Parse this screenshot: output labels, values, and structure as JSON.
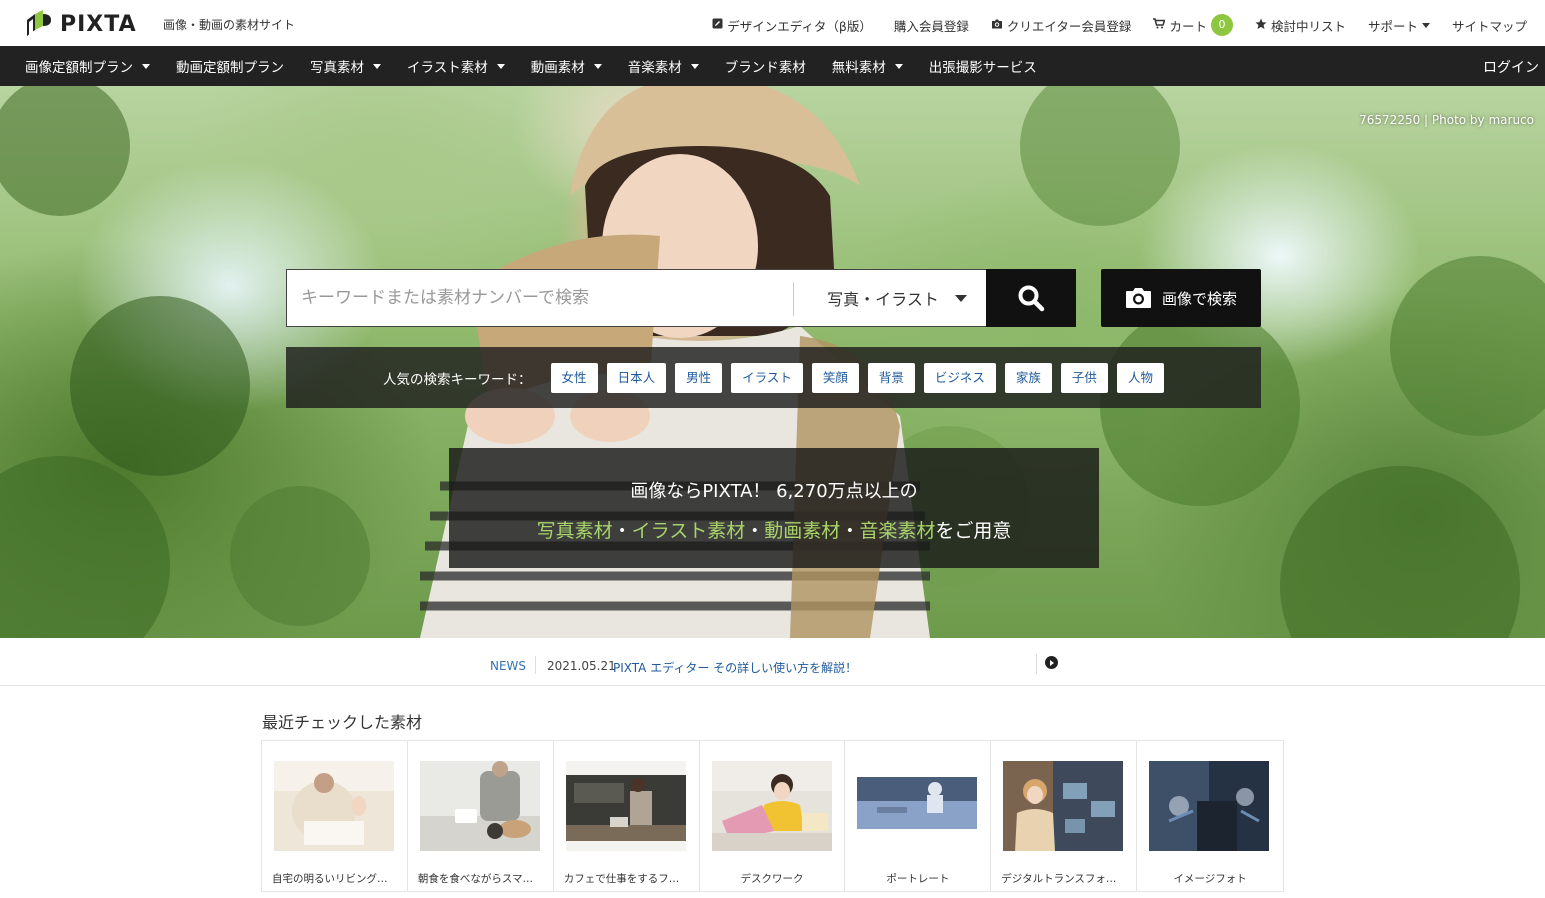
{
  "header": {
    "logo_text": "PIXTA",
    "tagline": "画像・動画の素材サイト",
    "links": [
      {
        "icon": "pencil-icon",
        "label": "デザインエディタ（β版）"
      },
      {
        "icon": "",
        "label": "購入会員登録"
      },
      {
        "icon": "camera-icon",
        "label": "クリエイター会員登録"
      },
      {
        "icon": "cart-icon",
        "label": "カート",
        "badge": "0"
      },
      {
        "icon": "star-icon",
        "label": "検討中リスト"
      },
      {
        "icon": "",
        "label": "サポート",
        "dropdown": true
      },
      {
        "icon": "",
        "label": "サイトマップ"
      }
    ]
  },
  "nav": {
    "items": [
      {
        "label": "画像定額制プラン",
        "dropdown": true
      },
      {
        "label": "動画定額制プラン",
        "dropdown": false
      },
      {
        "label": "写真素材",
        "dropdown": true
      },
      {
        "label": "イラスト素材",
        "dropdown": true
      },
      {
        "label": "動画素材",
        "dropdown": true
      },
      {
        "label": "音楽素材",
        "dropdown": true
      },
      {
        "label": "ブランド素材",
        "dropdown": false
      },
      {
        "label": "無料素材",
        "dropdown": true
      },
      {
        "label": "出張撮影サービス",
        "dropdown": false
      }
    ],
    "login": "ログイン"
  },
  "hero": {
    "photo_id": "76572250",
    "photo_credit_sep": " | Photo by ",
    "photographer": "maruco",
    "search": {
      "placeholder": "キーワードまたは素材ナンバーで検索",
      "value": "",
      "category": "写真・イラスト"
    },
    "image_search_label": "画像で検索",
    "popular_label": "人気の検索キーワード：",
    "keywords": [
      "女性",
      "日本人",
      "男性",
      "イラスト",
      "笑顔",
      "背景",
      "ビジネス",
      "家族",
      "子供",
      "人物"
    ],
    "promo": {
      "line1": "画像ならPIXTA！ 6,270万点以上の",
      "links": [
        "写真素材",
        "イラスト素材",
        "動画素材",
        "音楽素材"
      ],
      "separator": "・",
      "suffix": "をご用意"
    }
  },
  "news": {
    "label": "NEWS",
    "date": "2021.05.21",
    "text": "PIXTA エディター その詳しい使い方を解説！"
  },
  "recent": {
    "title": "最近チェックした素材",
    "items": [
      {
        "caption": "自宅の明るいリビングで…",
        "palette": [
          "#efe6da",
          "#d9cbb8",
          "#f4efe8"
        ]
      },
      {
        "caption": "朝食を食べながらスマー…",
        "palette": [
          "#e9e9e6",
          "#9b9b96",
          "#c9a27a"
        ]
      },
      {
        "caption": "カフェで仕事をするフリ…",
        "palette": [
          "#3a3a36",
          "#7a6a58",
          "#d8d4cc"
        ]
      },
      {
        "caption": "デスクワーク",
        "palette": [
          "#e6e2dc",
          "#e59ab4",
          "#f1c232"
        ]
      },
      {
        "caption": "ポートレート",
        "palette": [
          "#4a5d7a",
          "#8aa2c8",
          "#dfe6f0"
        ]
      },
      {
        "caption": "デジタルトランスフォー…",
        "palette": [
          "#3e4a5c",
          "#d8a56a",
          "#9fc6e0"
        ]
      },
      {
        "caption": "イメージフォト",
        "palette": [
          "#2e3b4e",
          "#6d8cb3",
          "#cfd9e6"
        ]
      }
    ]
  },
  "colors": {
    "accent_green": "#8dc63f",
    "promo_highlight": "#a8d46a",
    "nav_bg": "#222222",
    "link_blue": "#1f5a9b"
  }
}
